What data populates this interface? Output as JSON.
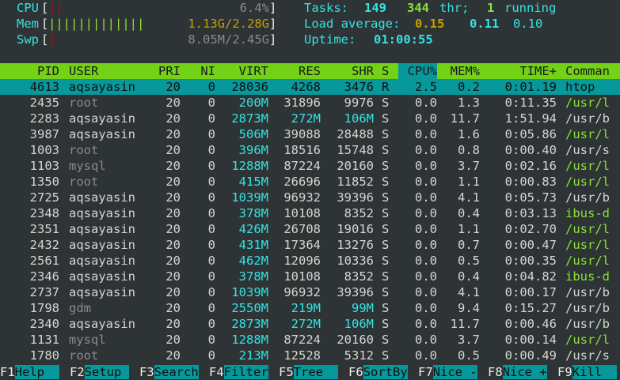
{
  "meters": {
    "cpu": {
      "label": "CPU",
      "bars": "||",
      "value": "6.4%"
    },
    "mem": {
      "label": "Mem",
      "bars": "|||||||||||||",
      "value": "1.13G/2.28G"
    },
    "swp": {
      "label": "Swp",
      "bars": "|",
      "value": "8.05M/2.45G"
    }
  },
  "summary": {
    "tasks_label": "Tasks:",
    "tasks": "149",
    "threads": "344",
    "thr_label": "thr;",
    "running": "1",
    "running_label": "running",
    "load_label": "Load average:",
    "load1": "0.15",
    "load5": "0.11",
    "load15": "0.10",
    "uptime_label": "Uptime:",
    "uptime": "01:00:55"
  },
  "columns": {
    "pid": "PID",
    "user": "USER",
    "pri": "PRI",
    "ni": "NI",
    "virt": "VIRT",
    "res": "RES",
    "shr": "SHR",
    "s": "S",
    "cpu": "CPU%",
    "mem": "MEM%",
    "time": "TIME+",
    "cmd": "Comman"
  },
  "processes": [
    {
      "pid": "4613",
      "user": "aqsayasin",
      "pri": "20",
      "ni": "0",
      "virt": "28036",
      "res": "4268",
      "shr": "3476",
      "s": "R",
      "cpu": "2.5",
      "mem": "0.2",
      "time": "0:01.19",
      "cmd": "htop"
    },
    {
      "pid": "2435",
      "user": "root",
      "pri": "20",
      "ni": "0",
      "virt": "200M",
      "res": "31896",
      "shr": "9976",
      "s": "S",
      "cpu": "0.0",
      "mem": "1.3",
      "time": "0:11.35",
      "cmd": "/usr/l"
    },
    {
      "pid": "2283",
      "user": "aqsayasin",
      "pri": "20",
      "ni": "0",
      "virt": "2873M",
      "res": "272M",
      "shr": "106M",
      "s": "S",
      "cpu": "0.0",
      "mem": "11.7",
      "time": "1:51.94",
      "cmd": "/usr/b"
    },
    {
      "pid": "3987",
      "user": "aqsayasin",
      "pri": "20",
      "ni": "0",
      "virt": "506M",
      "res": "39088",
      "shr": "28488",
      "s": "S",
      "cpu": "0.0",
      "mem": "1.6",
      "time": "0:05.86",
      "cmd": "/usr/l"
    },
    {
      "pid": "1003",
      "user": "root",
      "pri": "20",
      "ni": "0",
      "virt": "396M",
      "res": "18516",
      "shr": "15748",
      "s": "S",
      "cpu": "0.0",
      "mem": "0.8",
      "time": "0:00.40",
      "cmd": "/usr/s"
    },
    {
      "pid": "1103",
      "user": "mysql",
      "pri": "20",
      "ni": "0",
      "virt": "1288M",
      "res": "87224",
      "shr": "20160",
      "s": "S",
      "cpu": "0.0",
      "mem": "3.7",
      "time": "0:02.16",
      "cmd": "/usr/l"
    },
    {
      "pid": "1350",
      "user": "root",
      "pri": "20",
      "ni": "0",
      "virt": "415M",
      "res": "26696",
      "shr": "11852",
      "s": "S",
      "cpu": "0.0",
      "mem": "1.1",
      "time": "0:00.83",
      "cmd": "/usr/l"
    },
    {
      "pid": "2725",
      "user": "aqsayasin",
      "pri": "20",
      "ni": "0",
      "virt": "1039M",
      "res": "96932",
      "shr": "39396",
      "s": "S",
      "cpu": "0.0",
      "mem": "4.1",
      "time": "0:05.73",
      "cmd": "/usr/b"
    },
    {
      "pid": "2348",
      "user": "aqsayasin",
      "pri": "20",
      "ni": "0",
      "virt": "378M",
      "res": "10108",
      "shr": "8352",
      "s": "S",
      "cpu": "0.0",
      "mem": "0.4",
      "time": "0:03.13",
      "cmd": "ibus-d"
    },
    {
      "pid": "2351",
      "user": "aqsayasin",
      "pri": "20",
      "ni": "0",
      "virt": "426M",
      "res": "26708",
      "shr": "19016",
      "s": "S",
      "cpu": "0.0",
      "mem": "1.1",
      "time": "0:02.70",
      "cmd": "/usr/l"
    },
    {
      "pid": "2432",
      "user": "aqsayasin",
      "pri": "20",
      "ni": "0",
      "virt": "431M",
      "res": "17364",
      "shr": "13276",
      "s": "S",
      "cpu": "0.0",
      "mem": "0.7",
      "time": "0:00.47",
      "cmd": "/usr/l"
    },
    {
      "pid": "2561",
      "user": "aqsayasin",
      "pri": "20",
      "ni": "0",
      "virt": "462M",
      "res": "12096",
      "shr": "10336",
      "s": "S",
      "cpu": "0.0",
      "mem": "0.5",
      "time": "0:00.35",
      "cmd": "/usr/l"
    },
    {
      "pid": "2346",
      "user": "aqsayasin",
      "pri": "20",
      "ni": "0",
      "virt": "378M",
      "res": "10108",
      "shr": "8352",
      "s": "S",
      "cpu": "0.0",
      "mem": "0.4",
      "time": "0:04.82",
      "cmd": "ibus-d"
    },
    {
      "pid": "2737",
      "user": "aqsayasin",
      "pri": "20",
      "ni": "0",
      "virt": "1039M",
      "res": "96932",
      "shr": "39396",
      "s": "S",
      "cpu": "0.0",
      "mem": "4.1",
      "time": "0:00.17",
      "cmd": "/usr/b"
    },
    {
      "pid": "1798",
      "user": "gdm",
      "pri": "20",
      "ni": "0",
      "virt": "2550M",
      "res": "219M",
      "shr": "99M",
      "s": "S",
      "cpu": "0.0",
      "mem": "9.4",
      "time": "0:15.27",
      "cmd": "/usr/b"
    },
    {
      "pid": "2340",
      "user": "aqsayasin",
      "pri": "20",
      "ni": "0",
      "virt": "2873M",
      "res": "272M",
      "shr": "106M",
      "s": "S",
      "cpu": "0.0",
      "mem": "11.7",
      "time": "0:00.46",
      "cmd": "/usr/b"
    },
    {
      "pid": "1131",
      "user": "mysql",
      "pri": "20",
      "ni": "0",
      "virt": "1288M",
      "res": "87224",
      "shr": "20160",
      "s": "S",
      "cpu": "0.0",
      "mem": "3.7",
      "time": "0:00.14",
      "cmd": "/usr/l"
    },
    {
      "pid": "1780",
      "user": "root",
      "pri": "20",
      "ni": "0",
      "virt": "213M",
      "res": "12528",
      "shr": "5312",
      "s": "S",
      "cpu": "0.0",
      "mem": "0.5",
      "time": "0:00.49",
      "cmd": "/usr/s"
    }
  ],
  "fkeys": [
    {
      "key": "F1",
      "label": "Help  "
    },
    {
      "key": "F2",
      "label": "Setup "
    },
    {
      "key": "F3",
      "label": "Search"
    },
    {
      "key": "F4",
      "label": "Filter"
    },
    {
      "key": "F5",
      "label": "Tree  "
    },
    {
      "key": "F6",
      "label": "SortBy"
    },
    {
      "key": "F7",
      "label": "Nice -"
    },
    {
      "key": "F8",
      "label": "Nice +"
    },
    {
      "key": "F9",
      "label": "Kill  "
    }
  ],
  "colors": {
    "header_bg": "#73d216",
    "selected_bg": "#06989a",
    "background": "#2e3436"
  }
}
